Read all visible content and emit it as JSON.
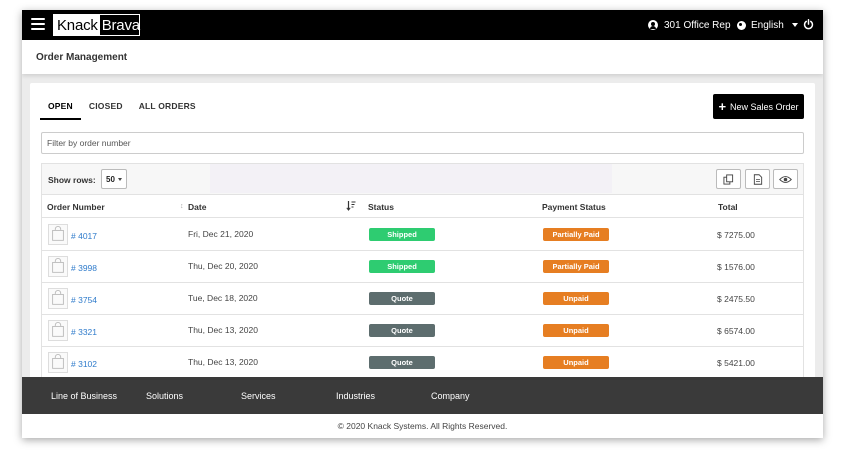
{
  "topbar": {
    "logo_part1": "Knack",
    "logo_part2": "Brava",
    "user_name": "301 Office Rep",
    "language": "English"
  },
  "page": {
    "title": "Order Management"
  },
  "tabs": [
    {
      "label": "OPEN",
      "active": true
    },
    {
      "label": "CIOSED",
      "active": false
    },
    {
      "label": "ALL ORDERS",
      "active": false
    }
  ],
  "new_order_label": "New Sales Order",
  "filter": {
    "placeholder": "Filter by order number"
  },
  "table": {
    "show_rows_label": "Show rows:",
    "rows_value": "50",
    "columns": [
      "Order Number",
      "Date",
      "Status",
      "Payment Status",
      "Total"
    ],
    "rows": [
      {
        "order": "# 4017",
        "date": "Fri, Dec 21, 2020",
        "status": "Shipped",
        "payment": "Partially Paid",
        "total": "$ 7275.00"
      },
      {
        "order": "# 3998",
        "date": "Thu, Dec 20, 2020",
        "status": "Shipped",
        "payment": "Partially Paid",
        "total": "$ 1576.00"
      },
      {
        "order": "# 3754",
        "date": "Tue, Dec 18, 2020",
        "status": "Quote",
        "payment": "Unpaid",
        "total": "$ 2475.50"
      },
      {
        "order": "# 3321",
        "date": "Thu, Dec 13, 2020",
        "status": "Quote",
        "payment": "Unpaid",
        "total": "$ 6574.00"
      },
      {
        "order": "# 3102",
        "date": "Thu, Dec 13, 2020",
        "status": "Quote",
        "payment": "Unpaid",
        "total": "$ 5421.00"
      }
    ]
  },
  "colors": {
    "shipped": "#2ecc71",
    "quote": "#5d6d6e",
    "partially_paid": "#e67e22",
    "unpaid": "#e67e22",
    "link": "#2f7bcb"
  },
  "footer": {
    "links": [
      "Line of Business",
      "Solutions",
      "Services",
      "Industries",
      "Company"
    ],
    "copyright": "© 2020 Knack Systems. All Rights Reserved."
  }
}
